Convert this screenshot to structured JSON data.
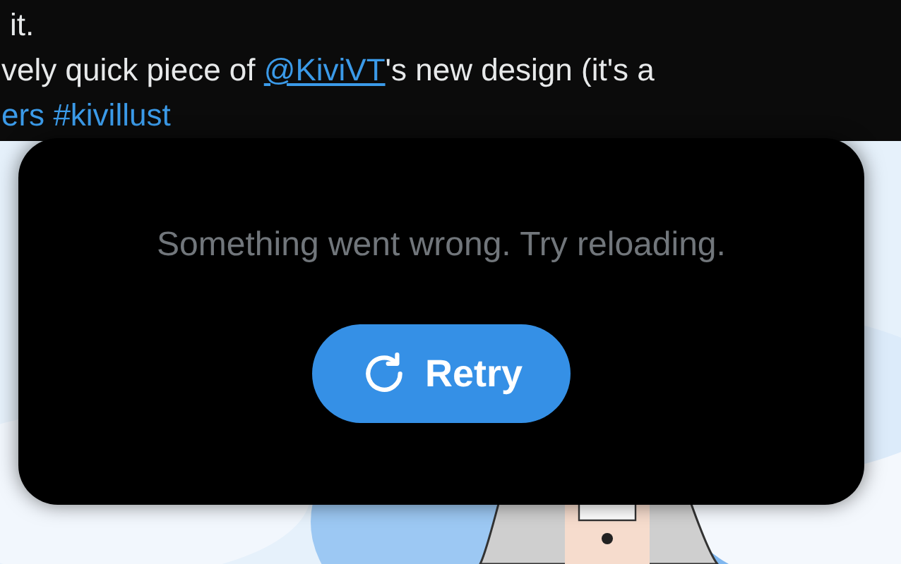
{
  "tweet": {
    "lines": [
      [
        {
          "kind": "text",
          "text": "it."
        }
      ],
      [
        {
          "kind": "text",
          "text": "vely quick piece of "
        },
        {
          "kind": "mention",
          "text": "@KiviVT"
        },
        {
          "kind": "text",
          "text": "'s new design (it's a"
        }
      ],
      [
        {
          "kind": "hashtag",
          "text": "ers"
        },
        {
          "kind": "hashtag",
          "text": "#kivillust"
        }
      ]
    ]
  },
  "error_card": {
    "message": "Something went wrong. Try reloading.",
    "button": {
      "label": "Retry"
    }
  }
}
